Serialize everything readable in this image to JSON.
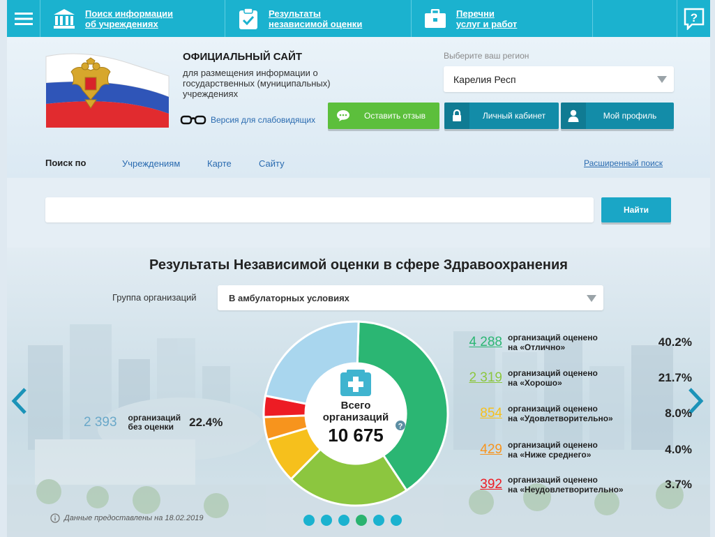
{
  "topnav": {
    "search_inst": "Поиск информации об учреждениях",
    "search_inst_l1": "Поиск информации",
    "search_inst_l2": "об учреждениях",
    "results_l1": "Результаты",
    "results_l2": "независимой оценки",
    "lists_l1": "Перечни",
    "lists_l2": "услуг и работ"
  },
  "header": {
    "title": "ОФИЦИАЛЬНЫЙ САЙТ",
    "subtitle": "для размещения информации о государственных (муниципальных) учреждениях",
    "low_vision": "Версия для слабовидящих",
    "region_label": "Выберите ваш регион",
    "region_value": "Карелия Респ",
    "feedback_btn": "Оставить отзыв",
    "cabinet_btn": "Личный кабинет",
    "profile_btn": "Мой профиль"
  },
  "search": {
    "by_label": "Поиск по",
    "tabs": [
      "Учреждениям",
      "Карте",
      "Сайту"
    ],
    "advanced": "Расширенный поиск",
    "input_value": "",
    "button": "Найти"
  },
  "results": {
    "title": "Результаты Независимой оценки в сфере Здравоохранения",
    "group_label": "Группа организаций",
    "group_value": "В амбулаторных условиях",
    "total_label_l1": "Всего",
    "total_label_l2": "организаций",
    "total_value": "10 675",
    "unrated": {
      "num": "2 393",
      "desc_l1": "организаций",
      "desc_l2": "без оценки",
      "pct": "22.4%"
    },
    "stats": [
      {
        "num": "4 288",
        "desc_l1": "организаций оценено",
        "desc_l2": "на «Отлично»",
        "pct": "40.2%",
        "color": "#2bb673"
      },
      {
        "num": "2 319",
        "desc_l1": "организаций оценено",
        "desc_l2": "на «Хорошо»",
        "pct": "21.7%",
        "color": "#8cc63f"
      },
      {
        "num": "854",
        "desc_l1": "организаций оценено",
        "desc_l2": "на «Удовлетворительно»",
        "pct": "8.0%",
        "color": "#f6c01c"
      },
      {
        "num": "429",
        "desc_l1": "организаций оценено",
        "desc_l2": "на «Ниже среднего»",
        "pct": "4.0%",
        "color": "#f7941d"
      },
      {
        "num": "392",
        "desc_l1": "организаций оценено",
        "desc_l2": "на «Неудовлетворительно»",
        "pct": "3.7%",
        "color": "#ed1c24"
      }
    ],
    "unrated_color": "#a9d6ee",
    "date_text": "Данные предоставлены на 18.02.2019",
    "slides_count": 6,
    "active_slide": 4
  }
}
